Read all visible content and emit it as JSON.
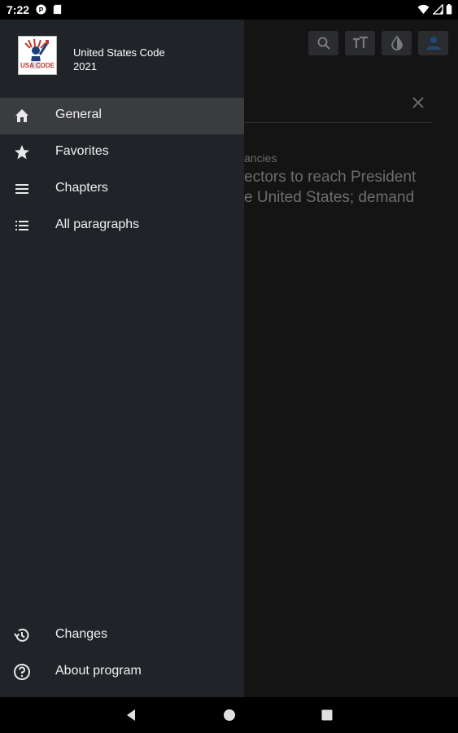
{
  "status_bar": {
    "time": "7:22"
  },
  "drawer": {
    "app_title": "United States Code\n2021",
    "logo_text": "USA CODE",
    "items": [
      {
        "label": "General",
        "icon": "home-icon",
        "active": true
      },
      {
        "label": "Favorites",
        "icon": "star-icon",
        "active": false
      },
      {
        "label": "Chapters",
        "icon": "menu-icon",
        "active": false
      },
      {
        "label": "All paragraphs",
        "icon": "list-icon",
        "active": false
      }
    ],
    "footer_items": [
      {
        "label": "Changes",
        "icon": "history-icon"
      },
      {
        "label": "About program",
        "icon": "help-icon"
      }
    ]
  },
  "background": {
    "toolbar_icons": [
      "search-icon",
      "text-size-icon",
      "contrast-icon",
      "user-icon"
    ],
    "subtitle": "ancies",
    "text_line_1": "ectors to reach President",
    "text_line_2": "e United States;  demand"
  },
  "colors": {
    "drawer_bg": "#202327",
    "active_item_bg": "#3a3c3f",
    "toolbar_accent": "#2f5f8f"
  }
}
